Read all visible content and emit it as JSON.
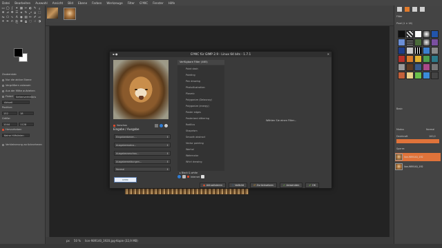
{
  "menubar": [
    "Datei",
    "Bearbeiten",
    "Auswahl",
    "Ansicht",
    "Bild",
    "Ebene",
    "Farben",
    "Werkzeuge",
    "Filter",
    "G'MIC",
    "Fenster",
    "Hilfe"
  ],
  "tool_options": {
    "title": "Zauberstab",
    "opt1": "Nur die aktive Ebene",
    "opt2": "Vergrößern zulassen",
    "opt3": "Aus der Mitte aufziehen",
    "opt4": "Fixiert",
    "opt4b": "Seitenverhältnis",
    "current": "Aktuell",
    "position_label": "Position:",
    "pos_x": "152",
    "pos_y": "18",
    "size_label": "Größe:",
    "size_w": "1044",
    "size_h": "1128",
    "highlight": "Hervorheben",
    "guides": "Keine Hilfslinien",
    "shrink": "Verkleinerung zurücknehmen"
  },
  "dialog": {
    "title": "G'MIC für GIMP 2.9 - Linux 64 bits - 1.7.1",
    "preview_label": "Vorschau",
    "io_label": "Eingabe / Ausgabe",
    "input_select": "Eingabeebenen...",
    "output_select": "Ausgabemodus...",
    "preview_mode": "Ausgabevorschau...",
    "output_msg": "Ausgabemeldungen...",
    "normal": "Normal",
    "logo": "G'MIC",
    "filters_head": "Verfügbare Filter (465)",
    "filters": [
      "Point dash",
      "Painting",
      "Pen drawing",
      "Photoillustration",
      "Plasmic",
      "Polygonize (Delaunay)",
      "Polygonize (energy)",
      "Poster edges",
      "Posterized dithering",
      "Rodilius",
      "Shapeism",
      "Smooth abstract",
      "Vector painting",
      "Warhol",
      "Watercolor",
      "Whirl drawing"
    ],
    "category": "Black & white",
    "internet": "Internet",
    "no_filter": "Wählen Sie einen Filter...",
    "buttons": {
      "update": "Aktualisieren",
      "fullscreen": "Vollbild",
      "reset": "Zurücksetzen",
      "apply": "Anwenden",
      "ok": "OK"
    }
  },
  "status": {
    "unit": "px",
    "zoom": "50 %",
    "file": "lion-989140_1920.jpg-Kopie (32,9 MB)"
  },
  "dock": {
    "filter_label": "Filter",
    "brush_label": "Pixel (1 × 16)",
    "basic": "Basic",
    "mode_label": "Modus",
    "mode": "Normal",
    "opacity_label": "Deckkraft",
    "opacity": "100,0",
    "lock_label": "Sperre:",
    "layer1": "lion-989140_192",
    "layer2": "lion-989140_192"
  },
  "colors": {
    "accent": "#e0733a",
    "danger": "#d64a2e",
    "apply_green": "#6fbf3a",
    "ok_green": "#7fcf4a"
  }
}
